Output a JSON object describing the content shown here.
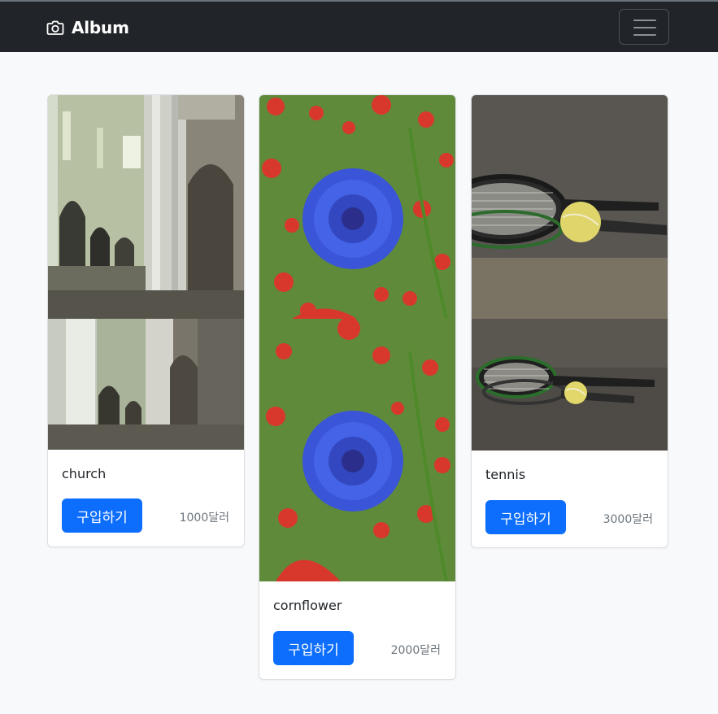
{
  "navbar": {
    "brand": "Album",
    "icon": "camera-icon",
    "toggler_icon": "hamburger-menu-icon"
  },
  "colors": {
    "navbar_bg": "#212529",
    "page_bg": "#f8f9fa",
    "primary": "#0d6efd",
    "muted": "#6c757d"
  },
  "cards": [
    {
      "title": "church",
      "button_label": "구입하기",
      "price": "1000달러"
    },
    {
      "title": "cornflower",
      "button_label": "구입하기",
      "price": "2000달러"
    },
    {
      "title": "tennis",
      "button_label": "구입하기",
      "price": "3000달러"
    }
  ]
}
